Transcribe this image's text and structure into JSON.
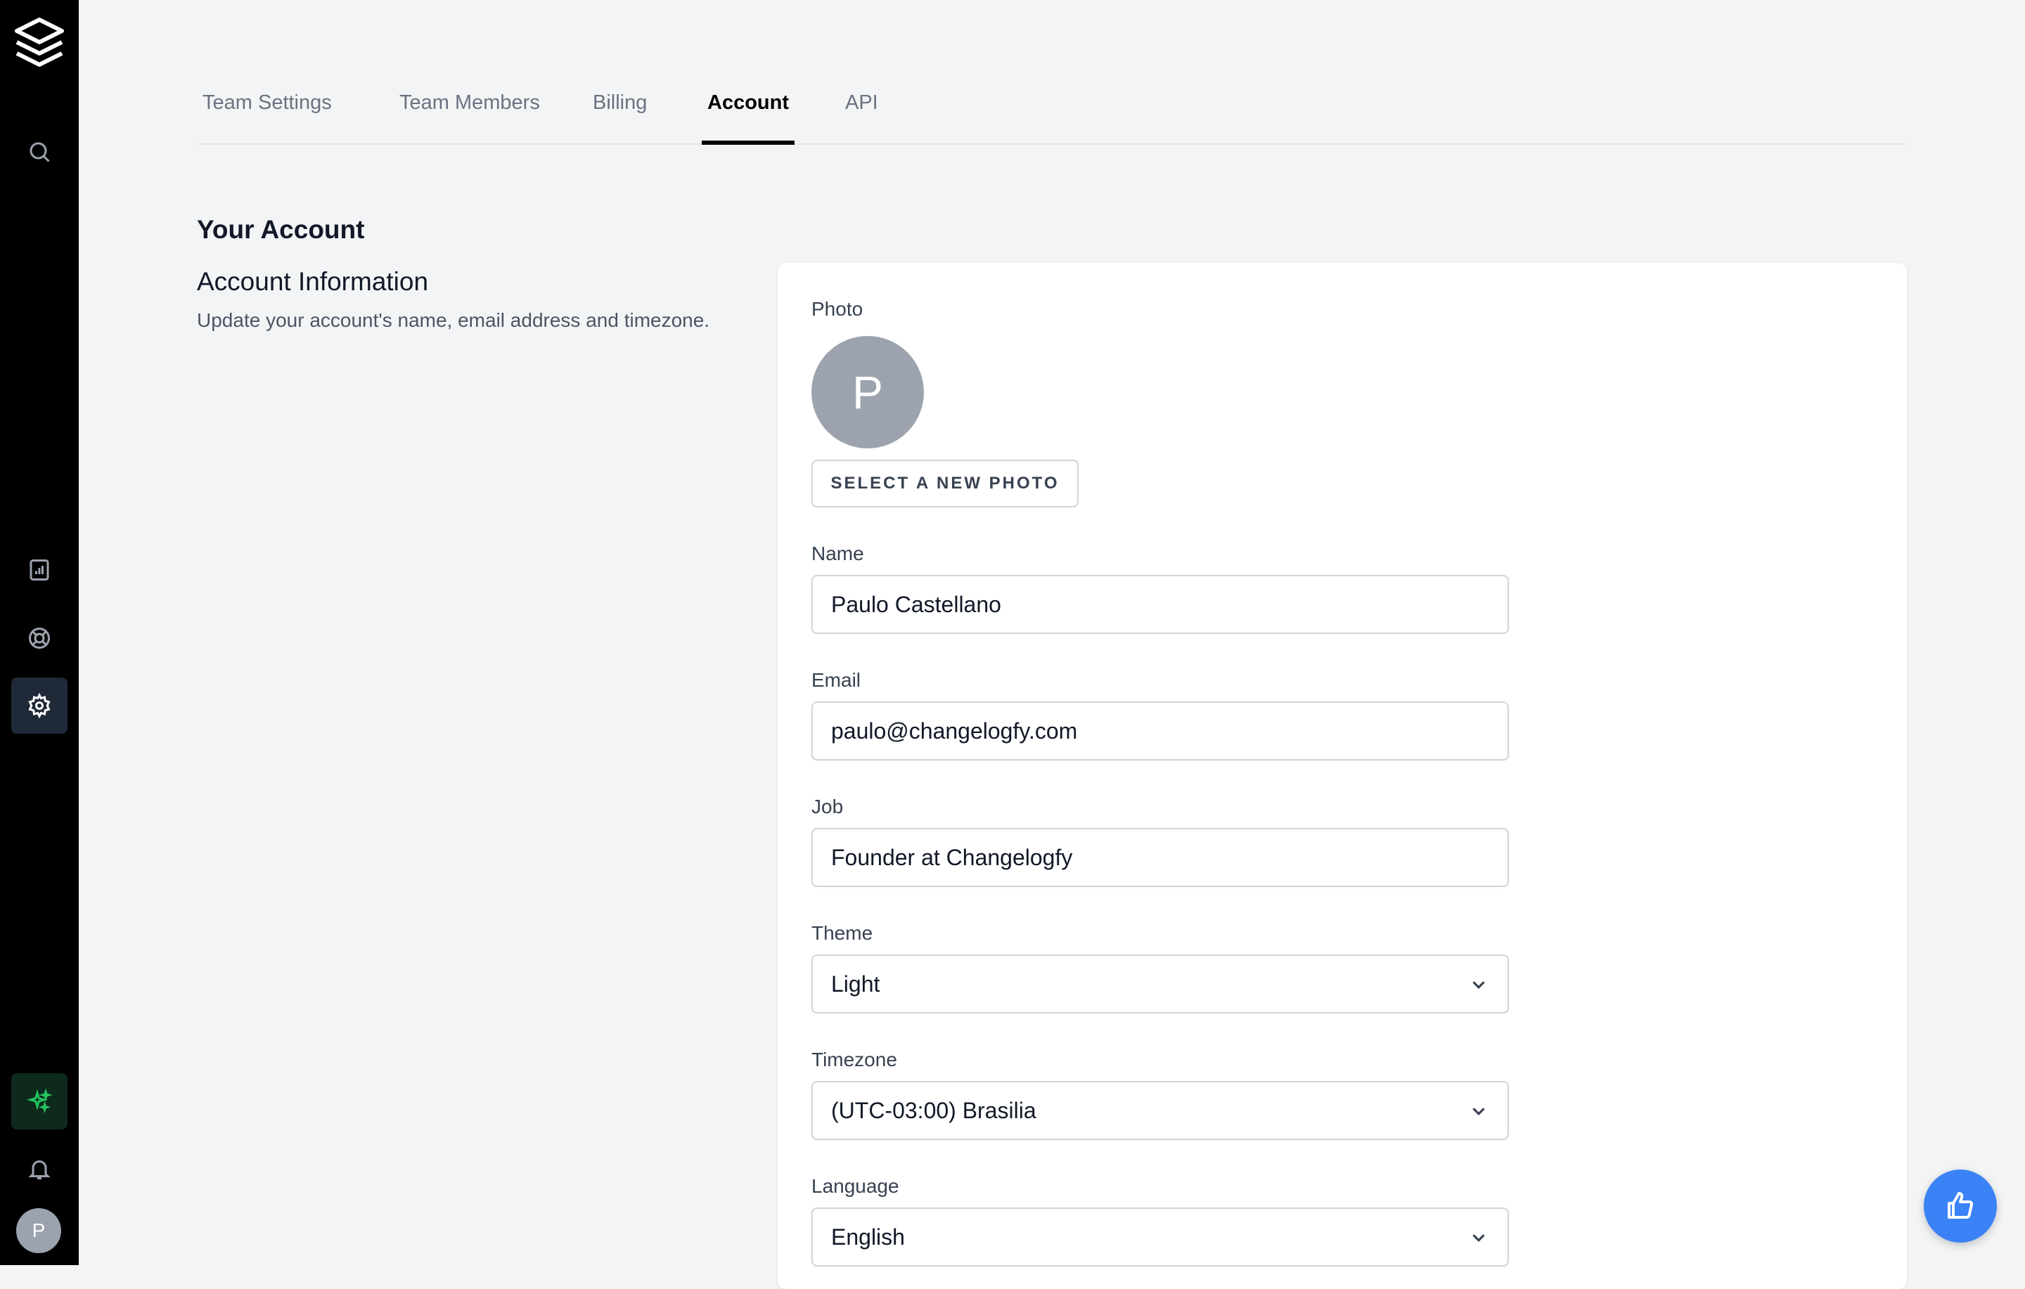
{
  "sidebar": {
    "avatar_initial": "P",
    "icons": [
      "logo-layers-icon",
      "search-icon",
      "chart-icon",
      "support-icon",
      "gear-icon",
      "sparkle-icon",
      "bell-icon"
    ],
    "active_item": "settings",
    "accent_color": "#22c55e"
  },
  "tabs": [
    {
      "label": "Team Settings"
    },
    {
      "label": "Team Members"
    },
    {
      "label": "Billing"
    },
    {
      "label": "Account",
      "active": true
    },
    {
      "label": "API"
    }
  ],
  "section": {
    "title": "Your Account",
    "subtitle": "Account Information",
    "description": "Update your account's name, email address and timezone."
  },
  "form": {
    "photo": {
      "label": "Photo",
      "initial": "P",
      "button_label": "SELECT A NEW PHOTO"
    },
    "name": {
      "label": "Name",
      "value": "Paulo Castellano"
    },
    "email": {
      "label": "Email",
      "value": "paulo@changelogfy.com"
    },
    "job": {
      "label": "Job",
      "value": "Founder at Changelogfy"
    },
    "theme": {
      "label": "Theme",
      "value": "Light"
    },
    "timezone": {
      "label": "Timezone",
      "value": "(UTC-03:00) Brasilia"
    },
    "language": {
      "label": "Language",
      "value": "English"
    }
  },
  "fab": {
    "icon": "thumbs-up-icon",
    "color": "#3b82f6"
  }
}
